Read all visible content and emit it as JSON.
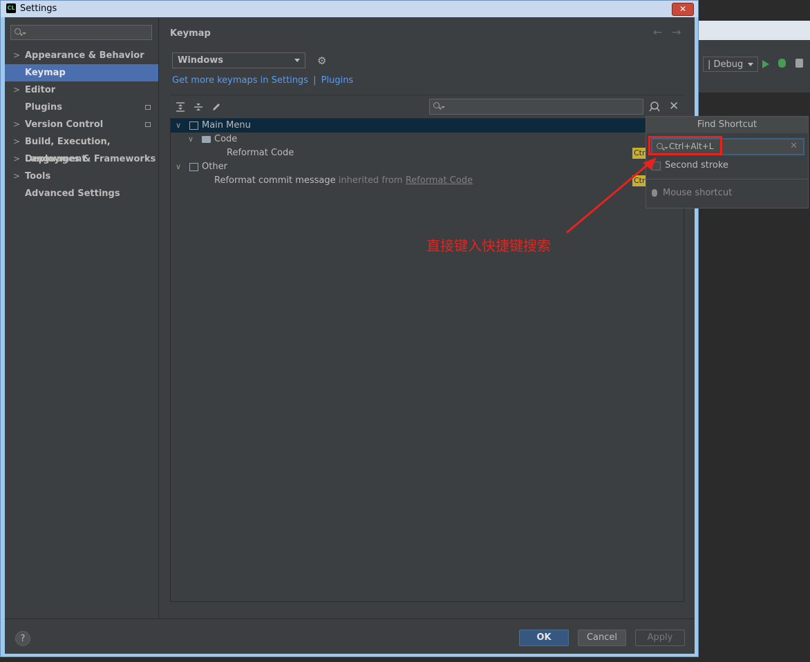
{
  "window": {
    "title": "Settings"
  },
  "sidebar": {
    "search_placeholder": "",
    "items": [
      {
        "label": "Appearance & Behavior"
      },
      {
        "label": "Keymap"
      },
      {
        "label": "Editor"
      },
      {
        "label": "Plugins"
      },
      {
        "label": "Version Control"
      },
      {
        "label": "Build, Execution, Deployment"
      },
      {
        "label": "Languages & Frameworks"
      },
      {
        "label": "Tools"
      },
      {
        "label": "Advanced Settings"
      }
    ]
  },
  "main": {
    "title": "Keymap",
    "keymap_selected": "Windows",
    "link_prefix": "Get more keymaps in Settings",
    "link_separator": "|",
    "link_plugins": "Plugins",
    "tree": {
      "main_menu": "Main Menu",
      "code": "Code",
      "reformat_code": "Reformat Code",
      "other": "Other",
      "reformat_commit": "Reformat commit message",
      "inherited_from": "inherited from",
      "inherited_target": "Reformat Code",
      "badge": "Ctrl"
    }
  },
  "popup": {
    "title": "Find Shortcut",
    "value": "Ctrl+Alt+L",
    "second_stroke": "Second stroke",
    "mouse_shortcut": "Mouse shortcut"
  },
  "buttons": {
    "ok": "OK",
    "cancel": "Cancel",
    "apply": "Apply",
    "help": "?"
  },
  "ide": {
    "run_config": "| Debug"
  },
  "annotation": {
    "text": "直接键入快捷键搜索",
    "color": "#e8221d"
  },
  "colors": {
    "selection": "#4b6eaf",
    "link": "#589df6",
    "ok_button": "#365880"
  }
}
